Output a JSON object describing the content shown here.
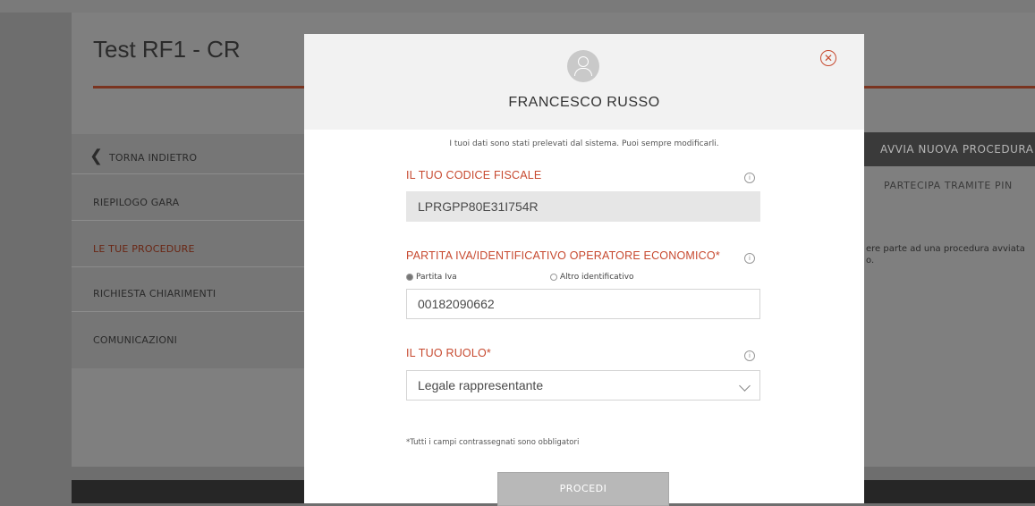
{
  "page": {
    "title": "Test RF1 - CR",
    "sidebar": {
      "back_label": "TORNA INDIETRO",
      "items": [
        "RIEPILOGO GARA",
        "LE TUE PROCEDURE",
        "RICHIESTA CHIARIMENTI",
        "COMUNICAZIONI"
      ],
      "active_index": 1
    },
    "actions": {
      "new_procedure": "AVVIA NUOVA PROCEDURA",
      "pin": "PARTECIPA TRAMITE PIN"
    },
    "right_text": [
      "ere parte ad una procedura avviata",
      "o."
    ]
  },
  "modal": {
    "user_name": "FRANCESCO RUSSO",
    "info_message": "I tuoi dati sono stati prelevati dal sistema. Puoi sempre modificarli.",
    "tax_code": {
      "label": "IL TUO CODICE FISCALE",
      "value": "LPRGPP80E31I754R"
    },
    "vat": {
      "label": "PARTITA IVA/IDENTIFICATIVO OPERATORE ECONOMICO*",
      "options": [
        "Partita Iva",
        "Altro identificativo"
      ],
      "selected": "Partita Iva",
      "value": "00182090662"
    },
    "role": {
      "label": "IL TUO RUOLO*",
      "value": "Legale rappresentante"
    },
    "footnote": "*Tutti i campi contrassegnati sono obbligatori",
    "proceed_label": "PROCEDI"
  },
  "colors": {
    "accent": "#c7492f",
    "overlay": "#6e6e6e",
    "footer": "#262626"
  }
}
